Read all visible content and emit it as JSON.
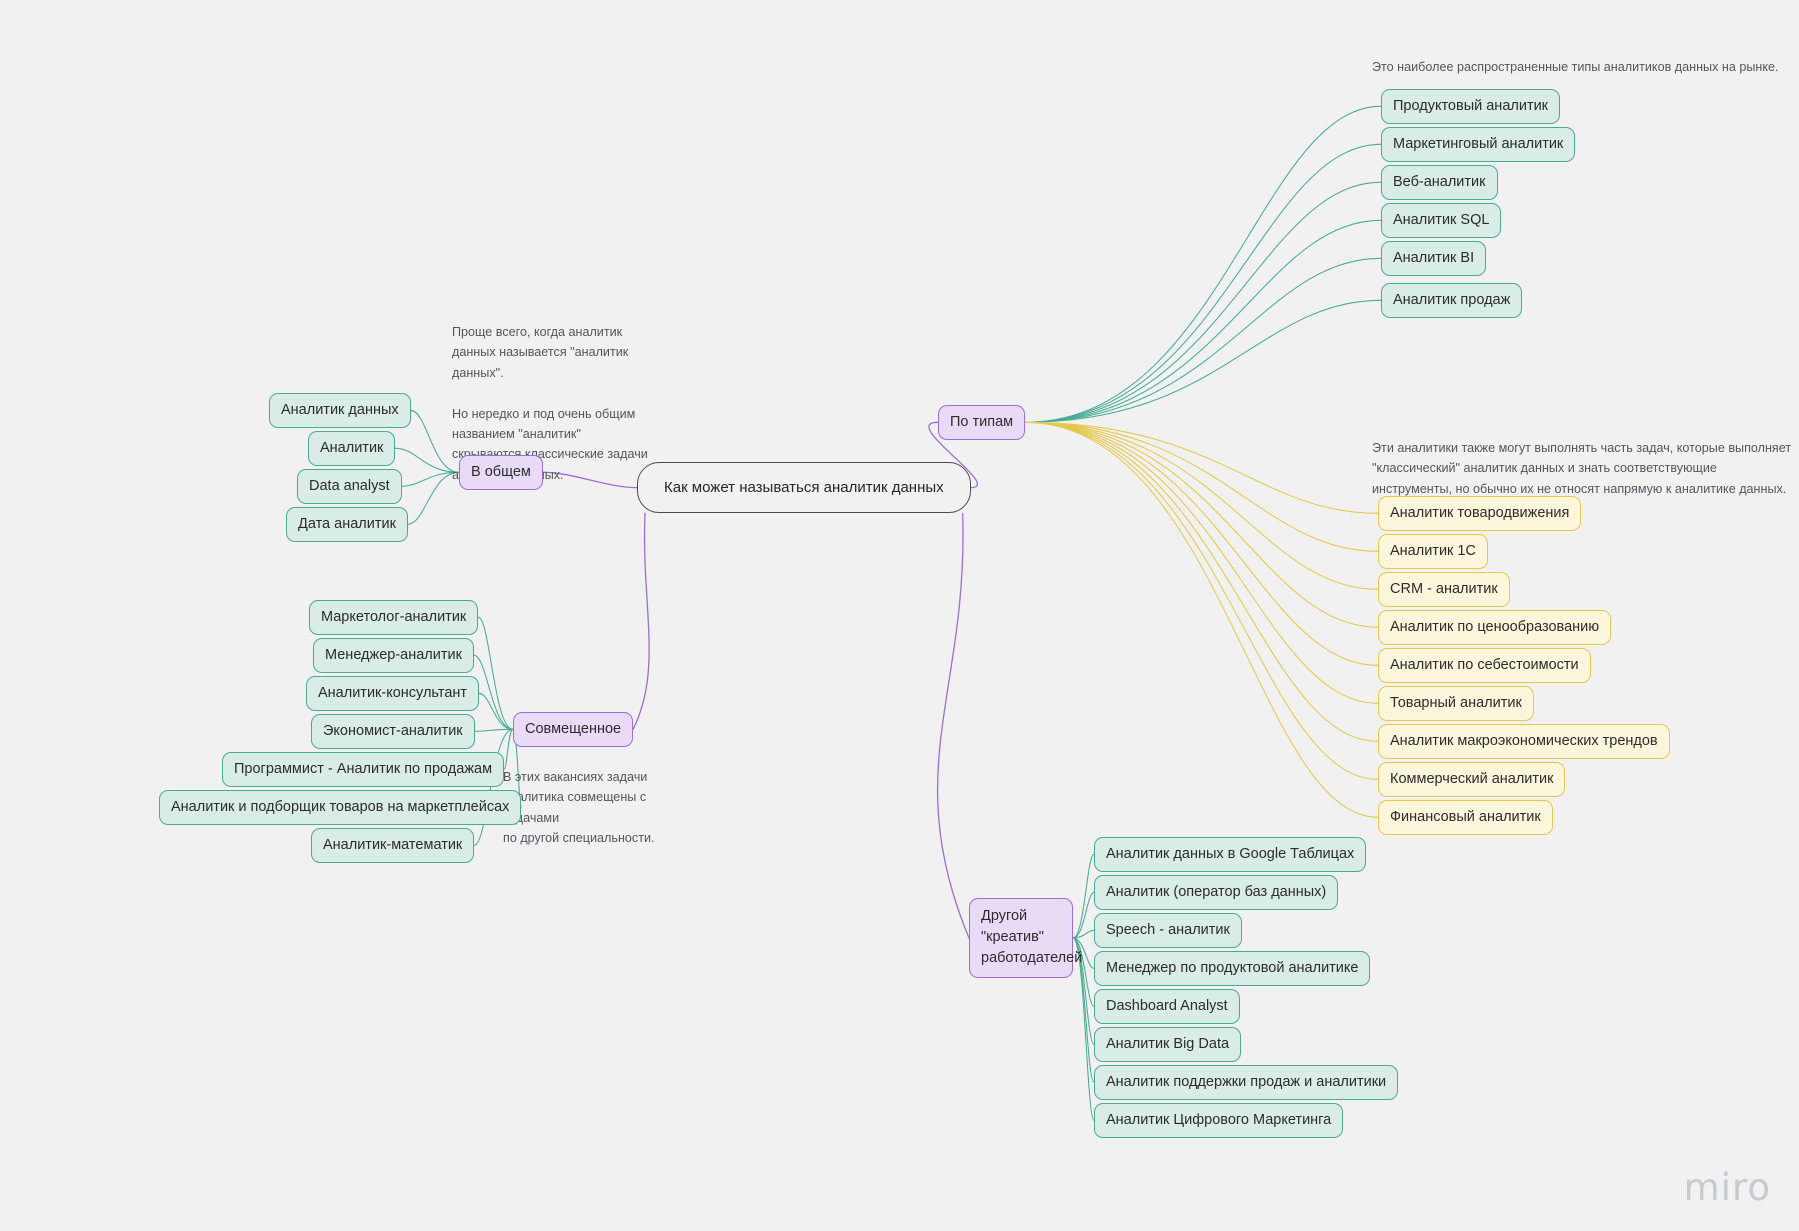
{
  "board": {
    "background_color": "#f1f1f1",
    "watermark": "miro"
  },
  "root": {
    "label": "Как может называться аналитик данных"
  },
  "branches": {
    "v_obshchem": {
      "label": "В общем",
      "note": "Проще всего, когда аналитик\nданных называется \"аналитик\nданных\".\n\nНо нередко и под очень общим\nназванием \"аналитик\"\nскрываются классические задачи\nаналитика данных.",
      "children": [
        "Аналитик данных",
        "Аналитик",
        "Data analyst",
        "Дата аналитик"
      ]
    },
    "sovmeshchennoe": {
      "label": "Совмещенное",
      "note": "В этих вакансиях задачи\nаналитика совмещены с задачами\nпо другой специальности.",
      "children": [
        "Маркетолог-аналитик",
        "Менеджер-аналитик",
        "Аналитик-консультант",
        "Экономист-аналитик",
        "Программист - Аналитик по продажам",
        "Аналитик и подборщик товаров на маркетплейсах",
        "Аналитик-математик"
      ]
    },
    "po_tipam": {
      "label": "По типам",
      "note_green": "Это наиболее распространенные типы аналитиков данных на рынке.",
      "note_yellow": "Эти аналитики также могут выполнять часть задач, которые выполняет\n\"классический\" аналитик данных и знать соответствующие\nинструменты, но обычно их не относят напрямую к аналитике данных.",
      "children_green": [
        "Продуктовый аналитик",
        "Маркетинговый аналитик",
        "Веб-аналитик",
        "Аналитик SQL",
        "Аналитик BI",
        "Аналитик продаж"
      ],
      "children_yellow": [
        "Аналитик товародвижения",
        "Аналитик 1С",
        "CRM - аналитик",
        "Аналитик по ценообразованию",
        "Аналитик по себестоимости",
        "Товарный аналитик",
        "Аналитик макроэкономических трендов",
        "Коммерческий аналитик",
        "Финансовый аналитик"
      ]
    },
    "drugoy_kreativ": {
      "label": "Другой\n\"креатив\"\nработодателей",
      "children": [
        "Аналитик данных в Google Таблицах",
        "Аналитик (оператор баз данных)",
        "Speech - аналитик",
        "Менеджер по продуктовой аналитике",
        "Dashboard Analyst",
        "Аналитик Big Data",
        "Аналитик поддержки продаж и аналитики",
        "Аналитик Цифрового Маркетинга"
      ]
    }
  },
  "colors": {
    "green_fill": "#d9ece6",
    "green_stroke": "#4aab93",
    "yellow_fill": "#fbf6dc",
    "yellow_stroke": "#e6c84b",
    "purple_fill": "#e9dbf7",
    "purple_stroke": "#9b6fd4",
    "root_stroke": "#4c4c4c",
    "note_text": "#54565a"
  }
}
